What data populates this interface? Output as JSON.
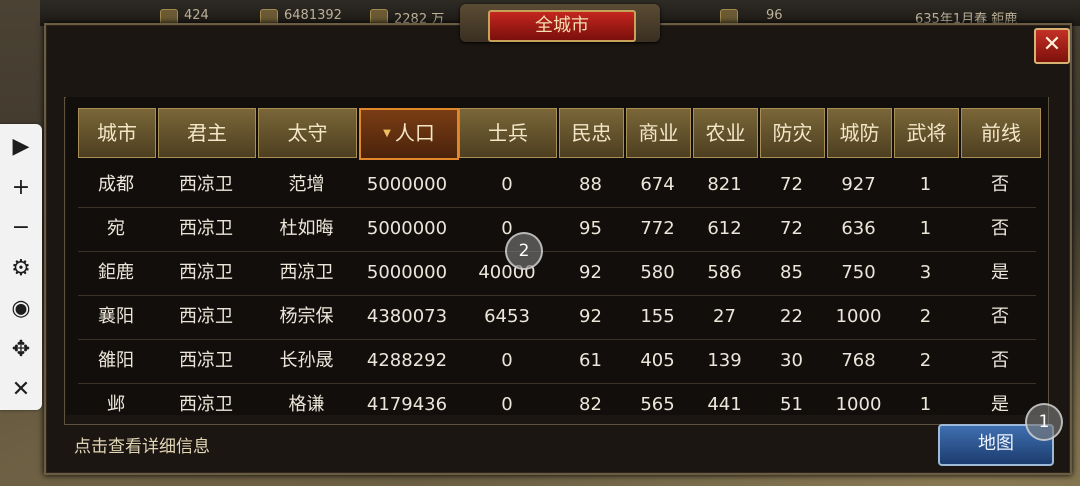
{
  "top_bar": {
    "values": [
      "424",
      "6481392",
      "2282 万",
      "96",
      "635年1月春 鉅鹿"
    ]
  },
  "dialog": {
    "title": "全城市",
    "close_label": "✕",
    "hint": "点击查看详细信息",
    "map_button": "地图"
  },
  "table": {
    "sort_indicator": "▼",
    "columns": [
      "城市",
      "君主",
      "太守",
      "人口",
      "士兵",
      "民忠",
      "商业",
      "农业",
      "防灾",
      "城防",
      "武将",
      "前线"
    ],
    "active_sort_column": "人口",
    "rows": [
      [
        "成都",
        "西凉卫",
        "范增",
        "5000000",
        "0",
        "88",
        "674",
        "821",
        "72",
        "927",
        "1",
        "否"
      ],
      [
        "宛",
        "西凉卫",
        "杜如晦",
        "5000000",
        "0",
        "95",
        "772",
        "612",
        "72",
        "636",
        "1",
        "否"
      ],
      [
        "鉅鹿",
        "西凉卫",
        "西凉卫",
        "5000000",
        "40000",
        "92",
        "580",
        "586",
        "85",
        "750",
        "3",
        "是"
      ],
      [
        "襄阳",
        "西凉卫",
        "杨宗保",
        "4380073",
        "6453",
        "92",
        "155",
        "27",
        "22",
        "1000",
        "2",
        "否"
      ],
      [
        "雒阳",
        "西凉卫",
        "长孙晟",
        "4288292",
        "0",
        "61",
        "405",
        "139",
        "30",
        "768",
        "2",
        "否"
      ],
      [
        "邺",
        "西凉卫",
        "格谦",
        "4179436",
        "0",
        "82",
        "565",
        "441",
        "51",
        "1000",
        "1",
        "是"
      ]
    ]
  },
  "toolbar": {
    "items": [
      {
        "icon": "play-icon",
        "glyph": "▶"
      },
      {
        "icon": "plus-icon",
        "glyph": "+"
      },
      {
        "icon": "minus-icon",
        "glyph": "−"
      },
      {
        "icon": "gear-icon",
        "glyph": "⚙"
      },
      {
        "icon": "eye-off-icon",
        "glyph": "◉"
      },
      {
        "icon": "move-icon",
        "glyph": "✥"
      },
      {
        "icon": "close-icon",
        "glyph": "✕"
      }
    ]
  },
  "touch_markers": [
    "2",
    "1"
  ],
  "colors": {
    "header_gold": "#7a6638",
    "active_header_border": "#e3872b",
    "title_red": "#c4261f",
    "map_button_blue": "#3f6fb0"
  }
}
